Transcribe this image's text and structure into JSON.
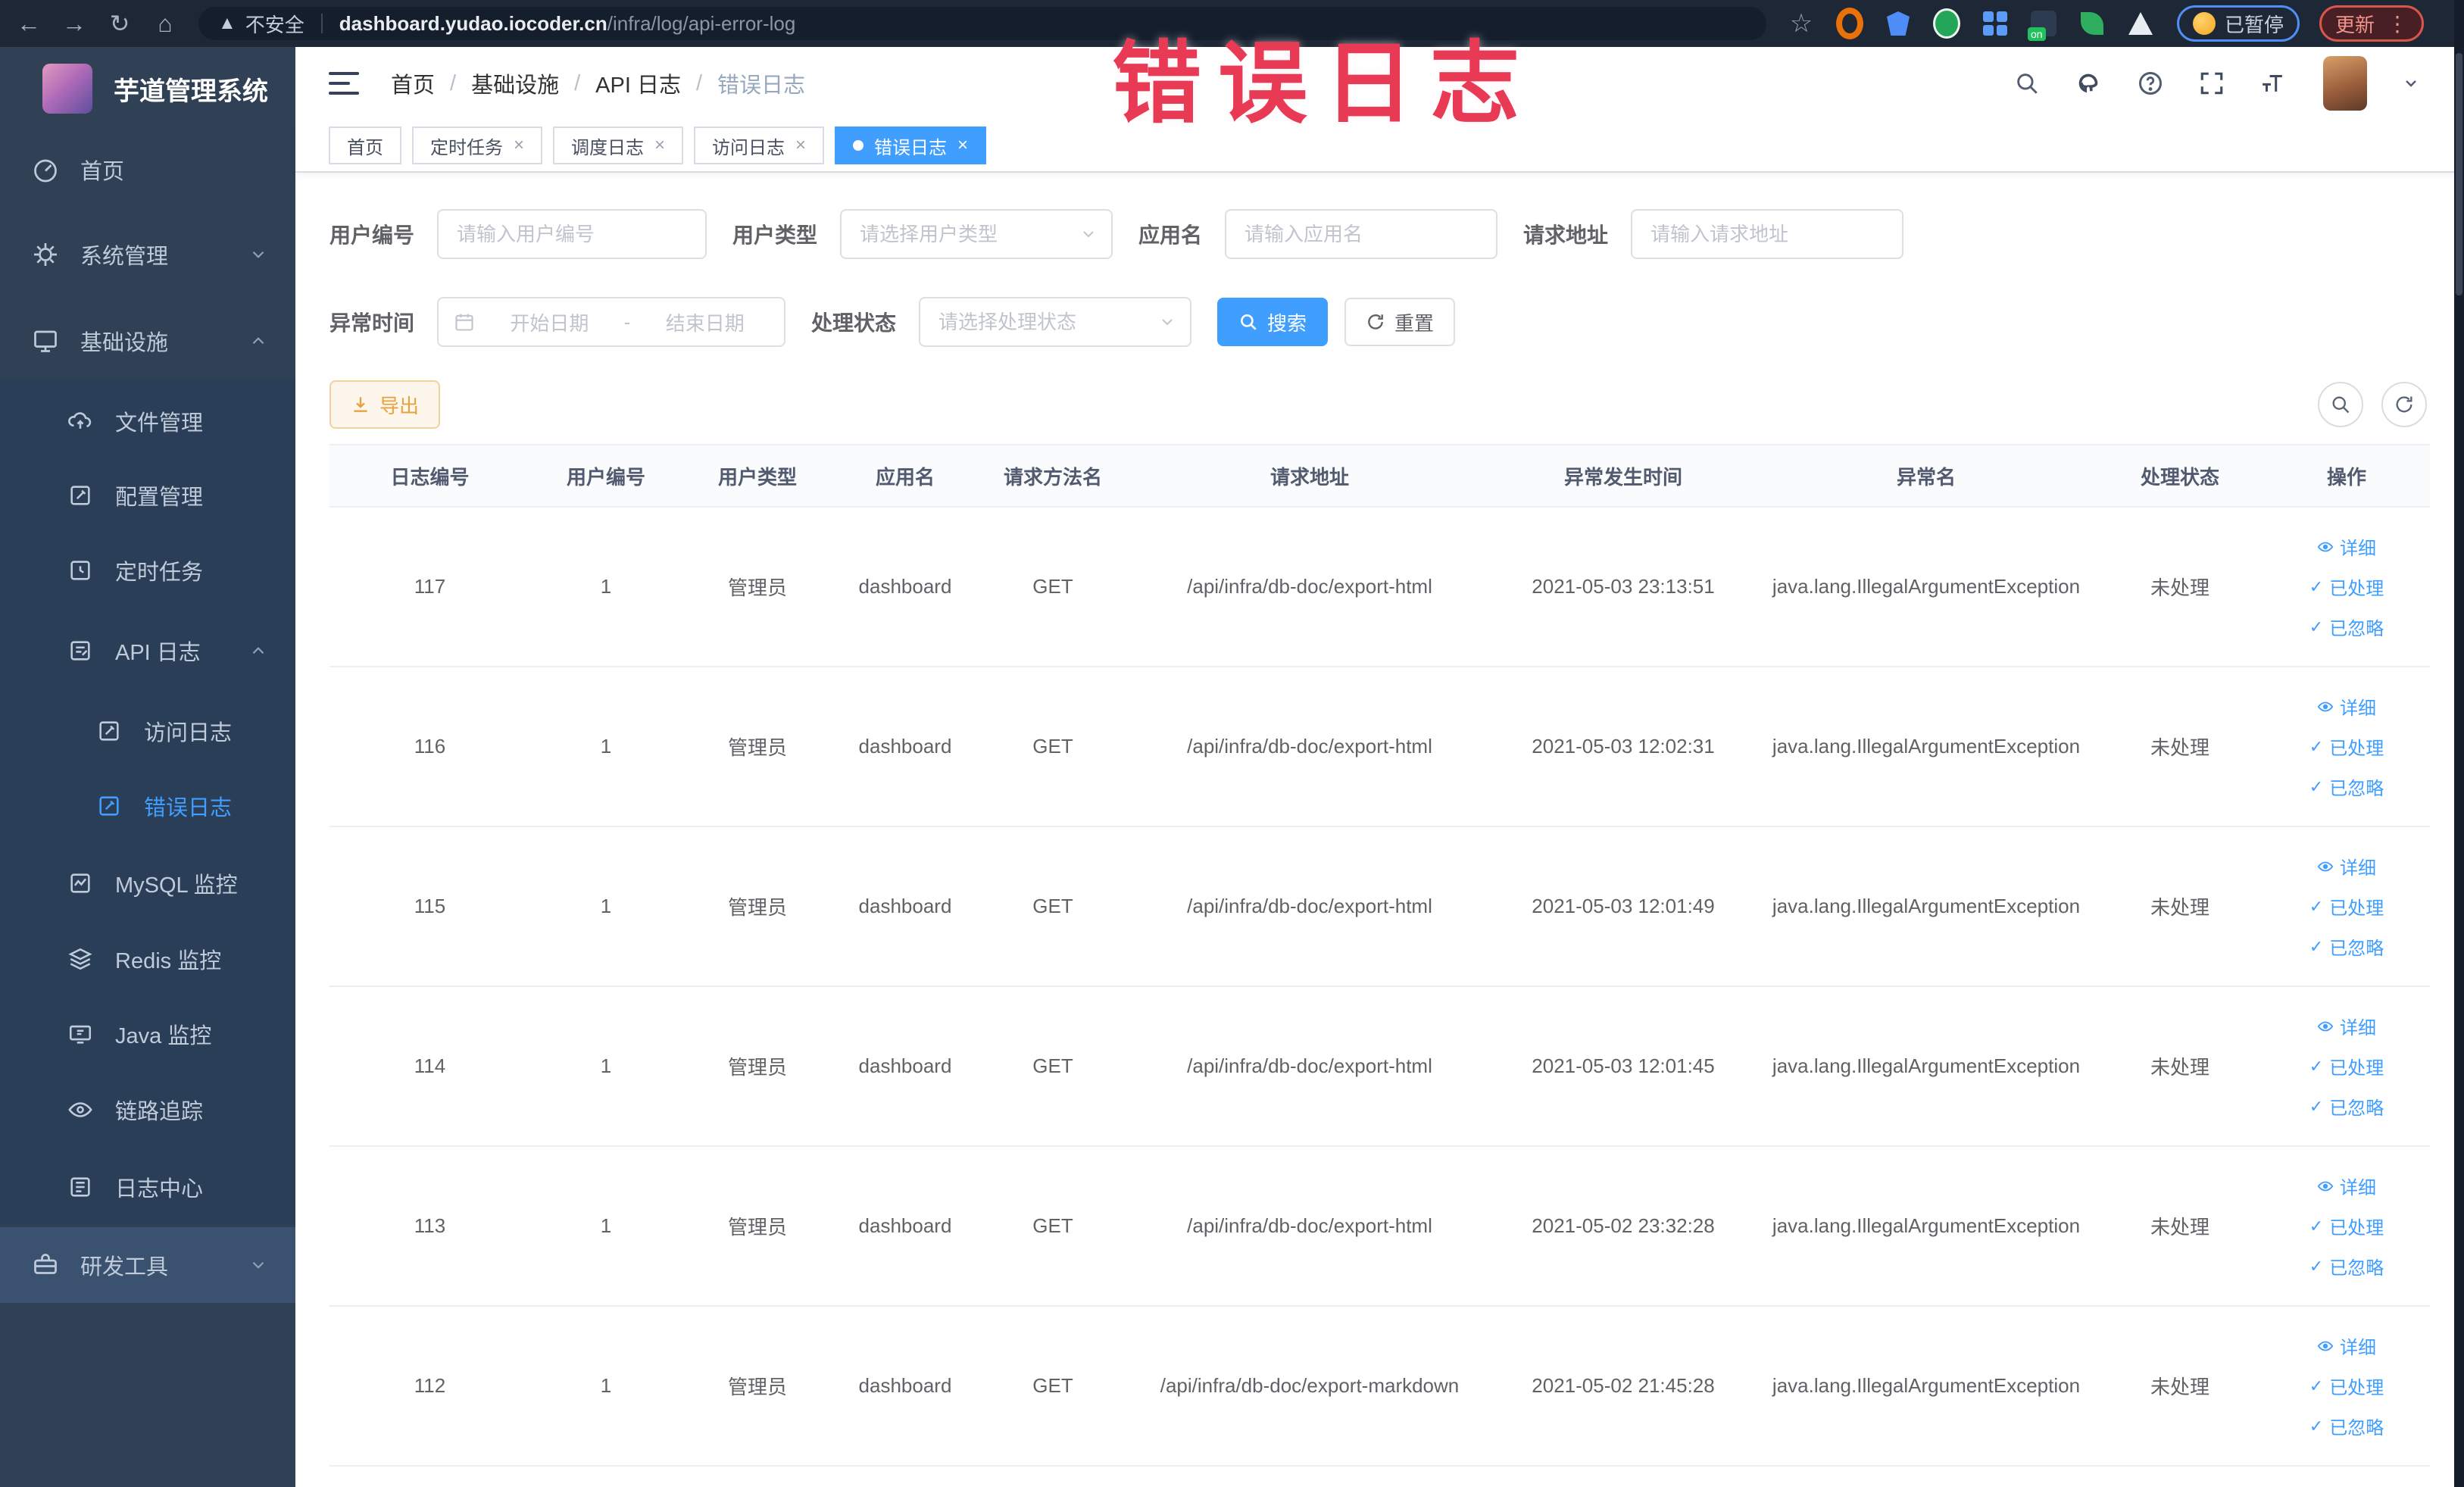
{
  "colors": {
    "accent": "#409eff",
    "overlay_red": "#e93a55",
    "export_orange": "#e6a23c",
    "sidebar_bg": "#304156"
  },
  "browser": {
    "security_label": "不安全",
    "url_host": "dashboard.yudao.iocoder.cn",
    "url_path": "/infra/log/api-error-log",
    "paused_label": "已暂停",
    "update_label": "更新"
  },
  "overlay": {
    "title": "错误日志"
  },
  "sidebar": {
    "logo_title": "芋道管理系统",
    "items": [
      {
        "label": "首页"
      },
      {
        "label": "系统管理"
      },
      {
        "label": "基础设施"
      },
      {
        "label": "文件管理"
      },
      {
        "label": "配置管理"
      },
      {
        "label": "定时任务"
      },
      {
        "label": "API 日志"
      },
      {
        "label": "访问日志"
      },
      {
        "label": "错误日志"
      },
      {
        "label": "MySQL 监控"
      },
      {
        "label": "Redis 监控"
      },
      {
        "label": "Java 监控"
      },
      {
        "label": "链路追踪"
      },
      {
        "label": "日志中心"
      },
      {
        "label": "研发工具"
      }
    ]
  },
  "breadcrumb": {
    "separator": "/",
    "items": [
      "首页",
      "基础设施",
      "API 日志",
      "错误日志"
    ]
  },
  "tabs": [
    {
      "label": "首页"
    },
    {
      "label": "定时任务"
    },
    {
      "label": "调度日志"
    },
    {
      "label": "访问日志"
    },
    {
      "label": "错误日志"
    }
  ],
  "filters": {
    "user_id": {
      "label": "用户编号",
      "placeholder": "请输入用户编号"
    },
    "user_type": {
      "label": "用户类型",
      "placeholder": "请选择用户类型"
    },
    "app_name": {
      "label": "应用名",
      "placeholder": "请输入应用名"
    },
    "request_url": {
      "label": "请求地址",
      "placeholder": "请输入请求地址"
    },
    "exception_time": {
      "label": "异常时间",
      "start_placeholder": "开始日期",
      "separator": "-",
      "end_placeholder": "结束日期"
    },
    "process_status": {
      "label": "处理状态",
      "placeholder": "请选择处理状态"
    },
    "search_label": "搜索",
    "reset_label": "重置"
  },
  "toolbar": {
    "export_label": "导出"
  },
  "table": {
    "headers": [
      "日志编号",
      "用户编号",
      "用户类型",
      "应用名",
      "请求方法名",
      "请求地址",
      "异常发生时间",
      "异常名",
      "处理状态",
      "操作"
    ],
    "actions": [
      "详细",
      "已处理",
      "已忽略"
    ],
    "rows": [
      {
        "log_id": "117",
        "user_id": "1",
        "user_type": "管理员",
        "app_name": "dashboard",
        "method": "GET",
        "request_url": "/api/infra/db-doc/export-html",
        "time": "2021-05-03 23:13:51",
        "exception_name": "java.lang.IllegalArgumentException",
        "status": "未处理"
      },
      {
        "log_id": "116",
        "user_id": "1",
        "user_type": "管理员",
        "app_name": "dashboard",
        "method": "GET",
        "request_url": "/api/infra/db-doc/export-html",
        "time": "2021-05-03 12:02:31",
        "exception_name": "java.lang.IllegalArgumentException",
        "status": "未处理"
      },
      {
        "log_id": "115",
        "user_id": "1",
        "user_type": "管理员",
        "app_name": "dashboard",
        "method": "GET",
        "request_url": "/api/infra/db-doc/export-html",
        "time": "2021-05-03 12:01:49",
        "exception_name": "java.lang.IllegalArgumentException",
        "status": "未处理"
      },
      {
        "log_id": "114",
        "user_id": "1",
        "user_type": "管理员",
        "app_name": "dashboard",
        "method": "GET",
        "request_url": "/api/infra/db-doc/export-html",
        "time": "2021-05-03 12:01:45",
        "exception_name": "java.lang.IllegalArgumentException",
        "status": "未处理"
      },
      {
        "log_id": "113",
        "user_id": "1",
        "user_type": "管理员",
        "app_name": "dashboard",
        "method": "GET",
        "request_url": "/api/infra/db-doc/export-html",
        "time": "2021-05-02 23:32:28",
        "exception_name": "java.lang.IllegalArgumentException",
        "status": "未处理"
      },
      {
        "log_id": "112",
        "user_id": "1",
        "user_type": "管理员",
        "app_name": "dashboard",
        "method": "GET",
        "request_url": "/api/infra/db-doc/export-markdown",
        "time": "2021-05-02 21:45:28",
        "exception_name": "java.lang.IllegalArgumentException",
        "status": "未处理"
      }
    ]
  }
}
